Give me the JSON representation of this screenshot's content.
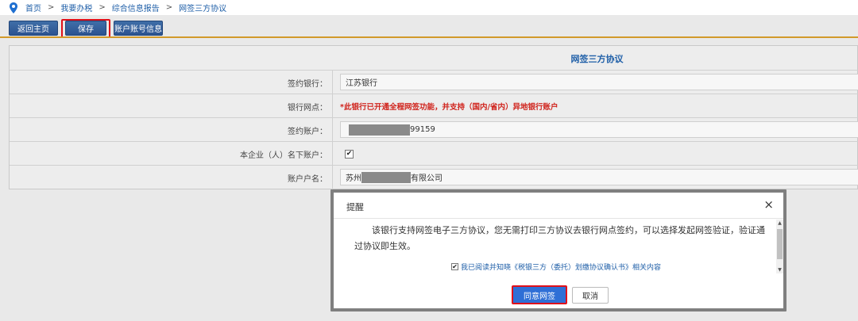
{
  "breadcrumb": {
    "items": [
      "首页",
      "我要办税",
      "综合信息报告",
      "网签三方协议"
    ],
    "separator": ">"
  },
  "toolbar": {
    "back_label": "返回主页",
    "save_label": "保存",
    "account_info_label": "账户账号信息"
  },
  "form": {
    "title": "网签三方协议",
    "rows": [
      {
        "label": "签约银行：",
        "value": "江苏银行"
      },
      {
        "label": "银行网点：",
        "value": "*此银行已开通全程网签功能，并支持（国内/省内）异地银行账户"
      },
      {
        "label": "签约账户：",
        "value": "99159"
      },
      {
        "label": "本企业（人）名下账户：",
        "checked": true
      },
      {
        "label": "账户户名：",
        "value_prefix": "苏州",
        "value_suffix": "有限公司"
      }
    ]
  },
  "modal": {
    "title": "提醒",
    "close_label": "×",
    "message": "该银行支持网签电子三方协议，您无需打印三方协议去银行网点签约，可以选择发起网签验证，验证通过协议即生效。",
    "agree_text": "我已阅读并知晓《税银三方（委托）划缴协议确认书》相关内容",
    "agree_checked": true,
    "confirm_label": "同意网签",
    "cancel_label": "取消"
  },
  "colors": {
    "accent_blue": "#1f5fa8",
    "toolbar_button": "#2c5390",
    "primary_button": "#2f6fd6",
    "highlight_red": "#e0101a",
    "notice_red": "#d0231c",
    "divider_orange": "#d29a2a"
  },
  "icons": {
    "location": "location-pin-icon",
    "close": "close-icon",
    "checkbox": "checkbox-checked-icon"
  }
}
